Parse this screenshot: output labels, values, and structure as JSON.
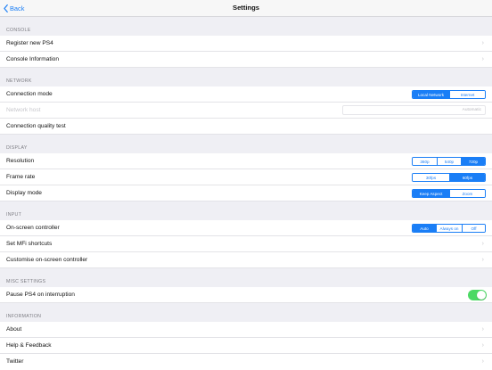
{
  "navbar": {
    "back_label": "Back",
    "title": "Settings"
  },
  "colors": {
    "accent": "#1a7ef6",
    "toggle_on": "#4cd964",
    "background": "#efeff4"
  },
  "console": {
    "header": "CONSOLE",
    "register": "Register new PS4",
    "info": "Console Information"
  },
  "network": {
    "header": "NETWORK",
    "connection_mode": {
      "label": "Connection mode",
      "options": [
        "Local Network",
        "Internet"
      ],
      "selected": "Local Network"
    },
    "network_host": {
      "label": "Network host",
      "value": "Automatic"
    },
    "quality_test": "Connection quality test"
  },
  "display": {
    "header": "DISPLAY",
    "resolution": {
      "label": "Resolution",
      "options": [
        "360p",
        "540p",
        "720p"
      ],
      "selected": "720p"
    },
    "frame_rate": {
      "label": "Frame rate",
      "options": [
        "30fps",
        "60fps"
      ],
      "selected": "60fps"
    },
    "display_mode": {
      "label": "Display mode",
      "options": [
        "Keep Aspect",
        "Zoom"
      ],
      "selected": "Keep Aspect"
    }
  },
  "input": {
    "header": "INPUT",
    "onscreen_controller": {
      "label": "On-screen controller",
      "options": [
        "Auto",
        "Always on",
        "Off"
      ],
      "selected": "Auto"
    },
    "mfi_shortcuts": "Set MFi shortcuts",
    "customise": "Customise on-screen controller"
  },
  "misc": {
    "header": "MISC SETTINGS",
    "pause": {
      "label": "Pause PS4 on interruption",
      "on": true
    }
  },
  "information": {
    "header": "INFORMATION",
    "about": "About",
    "help": "Help & Feedback",
    "twitter": "Twitter"
  }
}
